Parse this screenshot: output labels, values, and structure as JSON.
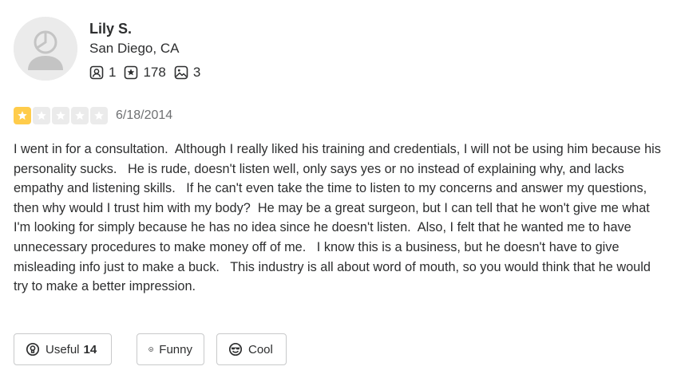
{
  "user": {
    "name": "Lily S.",
    "location": "San Diego, CA",
    "stats": {
      "friends": "1",
      "reviews": "178",
      "photos": "3"
    }
  },
  "review": {
    "rating": 1,
    "max_rating": 5,
    "date": "6/18/2014",
    "text": "I went in for a consultation.  Although I really liked his training and credentials, I will not be using him because his personality sucks.   He is rude, doesn't listen well, only says yes or no instead of explaining why, and lacks empathy and listening skills.   If he can't even take the time to listen to my concerns and answer my questions, then why would I trust him with my body?  He may be a great surgeon, but I can tell that he won't give me what I'm looking for simply because he has no idea since he doesn't listen.  Also, I felt that he wanted me to have unnecessary procedures to make money off of me.   I know this is a business, but he doesn't have to give misleading info just to make a buck.   This industry is all about word of mouth, so you would think that he would try to make a better impression."
  },
  "reactions": {
    "useful": {
      "label": "Useful",
      "count": "14"
    },
    "funny": {
      "label": "Funny"
    },
    "cool": {
      "label": "Cool"
    }
  },
  "colors": {
    "star_on": "#ffcc4b",
    "star_off": "#ebebeb",
    "text": "#2d2e2f",
    "muted": "#6e7072",
    "border": "#c8c9ca"
  },
  "icons": {
    "avatar": "default-user-avatar-icon",
    "friends": "friends-icon",
    "reviews": "review-star-icon",
    "photos": "photo-icon",
    "useful": "useful-lightbulb-icon",
    "funny": "funny-face-icon",
    "cool": "cool-sunglasses-icon"
  }
}
